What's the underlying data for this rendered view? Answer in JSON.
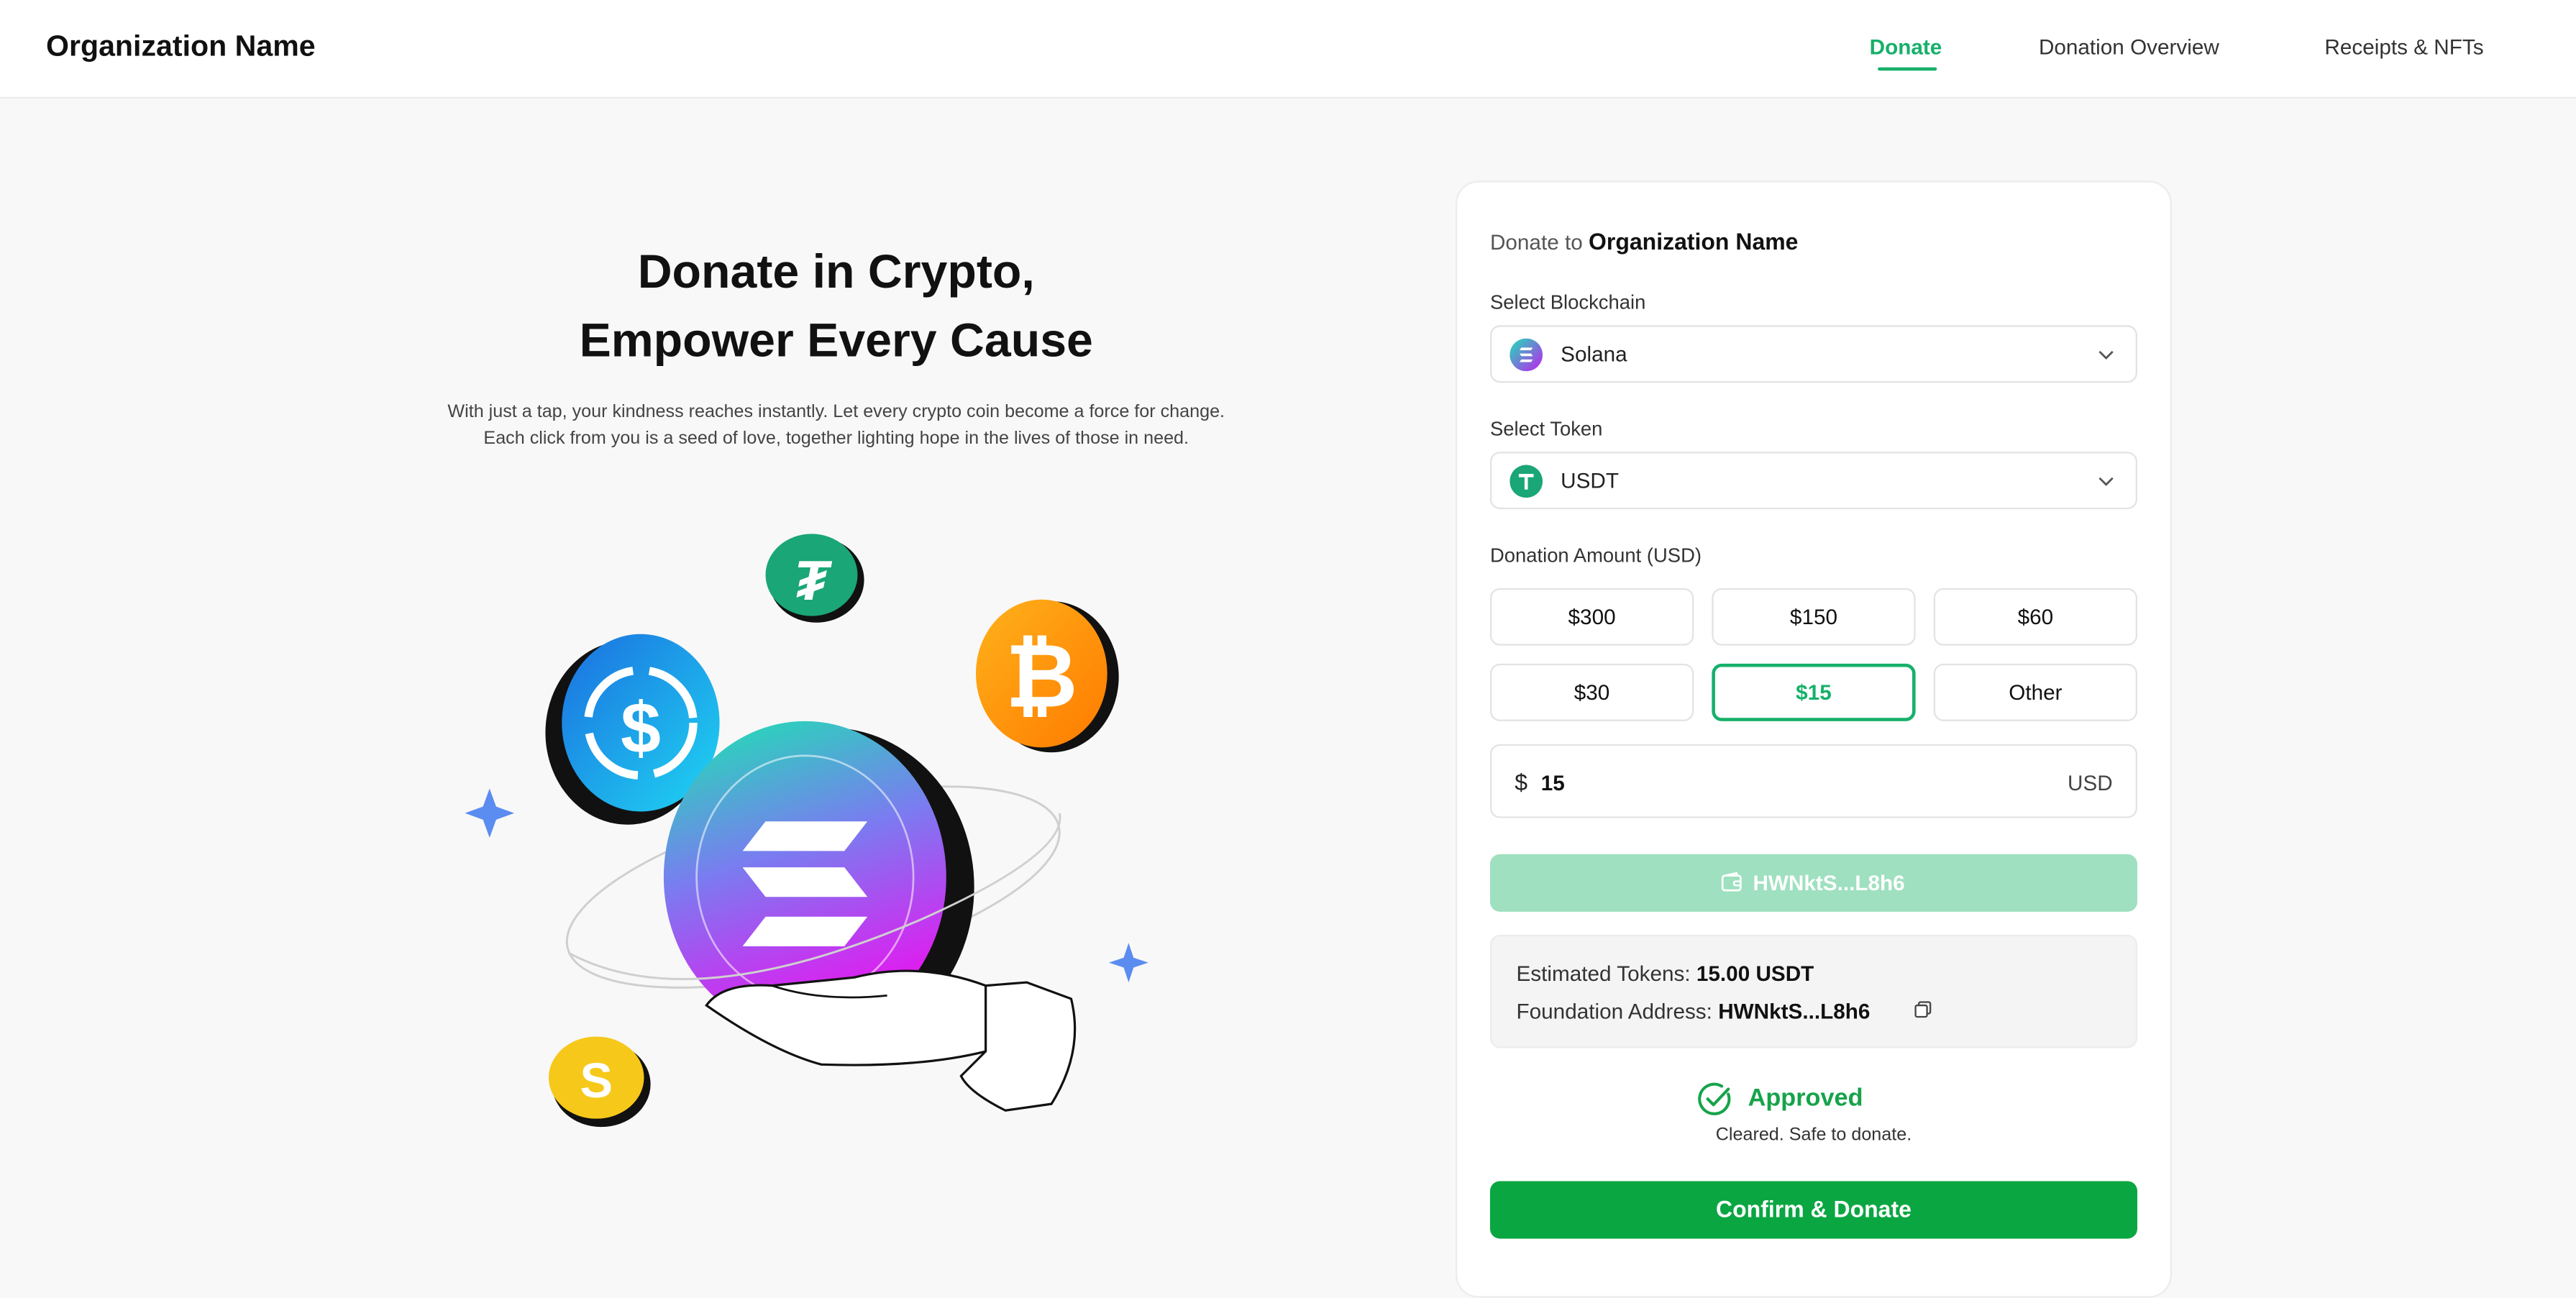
{
  "header": {
    "brand": "Organization Name",
    "nav": [
      {
        "label": "Donate",
        "active": true
      },
      {
        "label": "Donation Overview",
        "active": false
      },
      {
        "label": "Receipts & NFTs",
        "active": false
      }
    ]
  },
  "hero": {
    "title_line1": "Donate in Crypto,",
    "title_line2": "Empower Every Cause",
    "subtitle_line1": "With just a tap, your kindness reaches instantly. Let every crypto coin become a force for change.",
    "subtitle_line2": "Each click from you is a seed of love, together lighting hope in the lives of those in need."
  },
  "card": {
    "title_prefix": "Donate to",
    "title_org": "Organization Name",
    "blockchain_label": "Select Blockchain",
    "blockchain_value": "Solana",
    "token_label": "Select Token",
    "token_value": "USDT",
    "amount_label": "Donation Amount (USD)",
    "amount_options": [
      "$300",
      "$150",
      "$60",
      "$30",
      "$15",
      "Other"
    ],
    "selected_amount": "$15",
    "currency_symbol": "$",
    "amount_value": "15",
    "amount_unit": "USD",
    "wallet_label": "HWNktS...L8h6",
    "estimated_label": "Estimated Tokens:",
    "estimated_value": "15.00 USDT",
    "address_label": "Foundation Address:",
    "address_value": "HWNktS...L8h6",
    "status_title": "Approved",
    "status_sub": "Cleared. Safe to donate.",
    "confirm_label": "Confirm & Donate"
  },
  "colors": {
    "accent": "#16b06a",
    "confirm": "#0aa642",
    "wallet_disabled": "#9ee0bf",
    "background": "#f8f8f8"
  },
  "icons": [
    "solana-icon",
    "usdt-icon",
    "chevron-down-icon",
    "wallet-icon",
    "copy-icon",
    "check-circle-icon"
  ]
}
